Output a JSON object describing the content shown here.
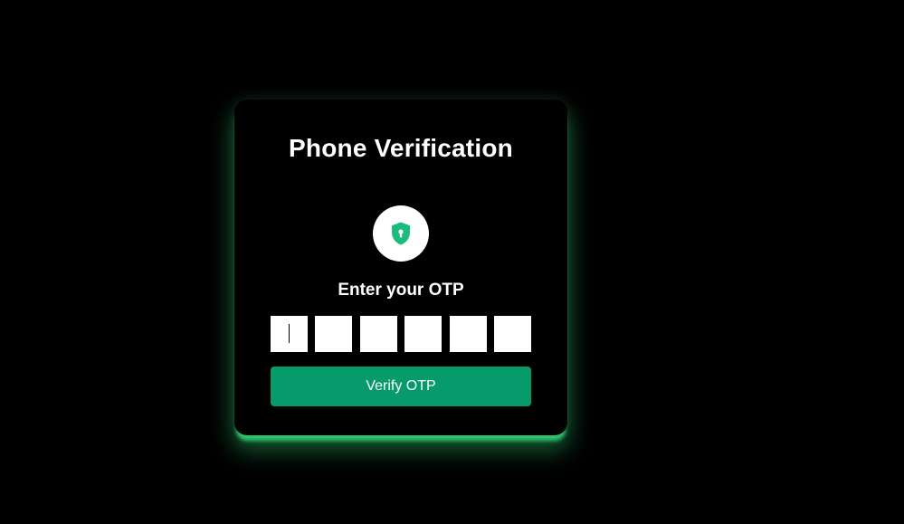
{
  "card": {
    "title": "Phone Verification",
    "icon": "shield-lock-icon",
    "subtitle": "Enter your OTP",
    "otp": {
      "length": 6,
      "values": [
        "",
        "",
        "",
        "",
        "",
        ""
      ],
      "focused_index": 0
    },
    "verify_label": "Verify OTP"
  },
  "colors": {
    "background": "#000000",
    "card_glow": "#2ecc71",
    "button": "#079a6b",
    "icon": "#1abc7c"
  }
}
